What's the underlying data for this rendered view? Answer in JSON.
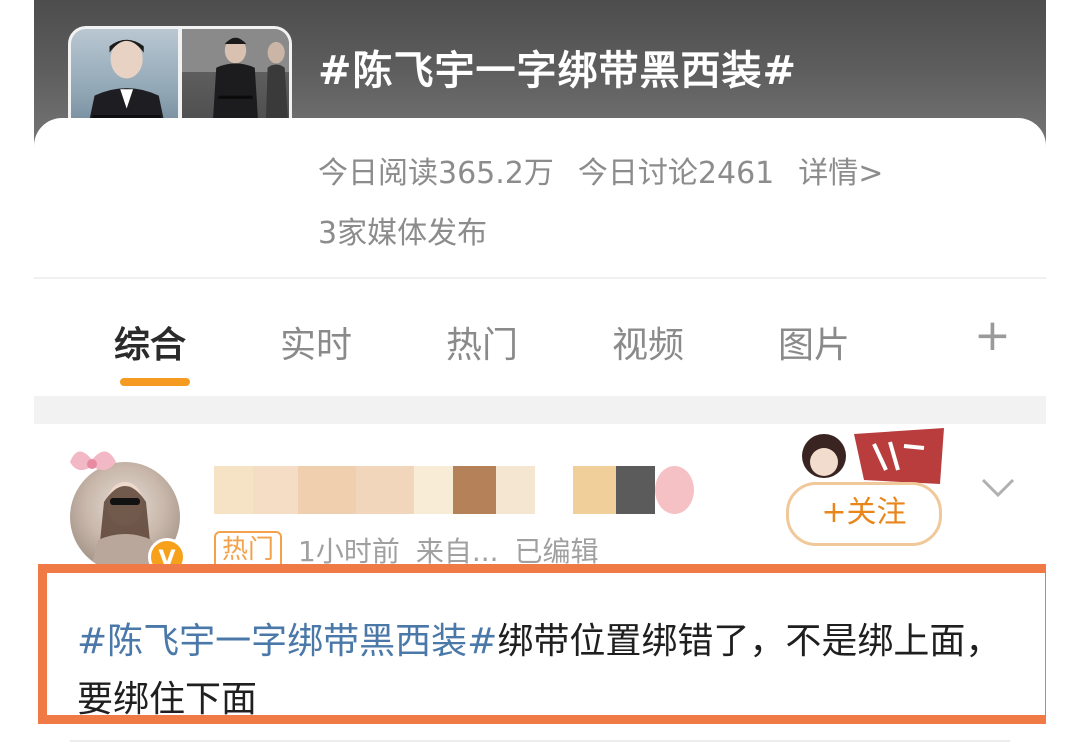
{
  "topic": {
    "title": "#陈飞宇一字绑带黑西装#",
    "stats": {
      "read": "今日阅读365.2万",
      "discuss": "今日讨论2461",
      "detail": "详情>"
    },
    "media": "3家媒体发布"
  },
  "tabs": [
    {
      "label": "综合",
      "active": true
    },
    {
      "label": "实时",
      "active": false
    },
    {
      "label": "热门",
      "active": false
    },
    {
      "label": "视频",
      "active": false
    },
    {
      "label": "图片",
      "active": false
    }
  ],
  "add_tab_label": "+",
  "post": {
    "badge": "V",
    "hot_tag": "热门",
    "time": "1小时前",
    "source": "来自...",
    "edited": "已编辑",
    "follow_label": "+关注",
    "hashtag": "#陈飞宇一字绑带黑西装#",
    "body": "绑带位置绑错了，不是绑上面，要绑住下面"
  },
  "colors": {
    "accent": "#f59b21",
    "highlight_border": "#f07a45",
    "hashtag": "#4a78a8",
    "follow": "#e8861b"
  }
}
